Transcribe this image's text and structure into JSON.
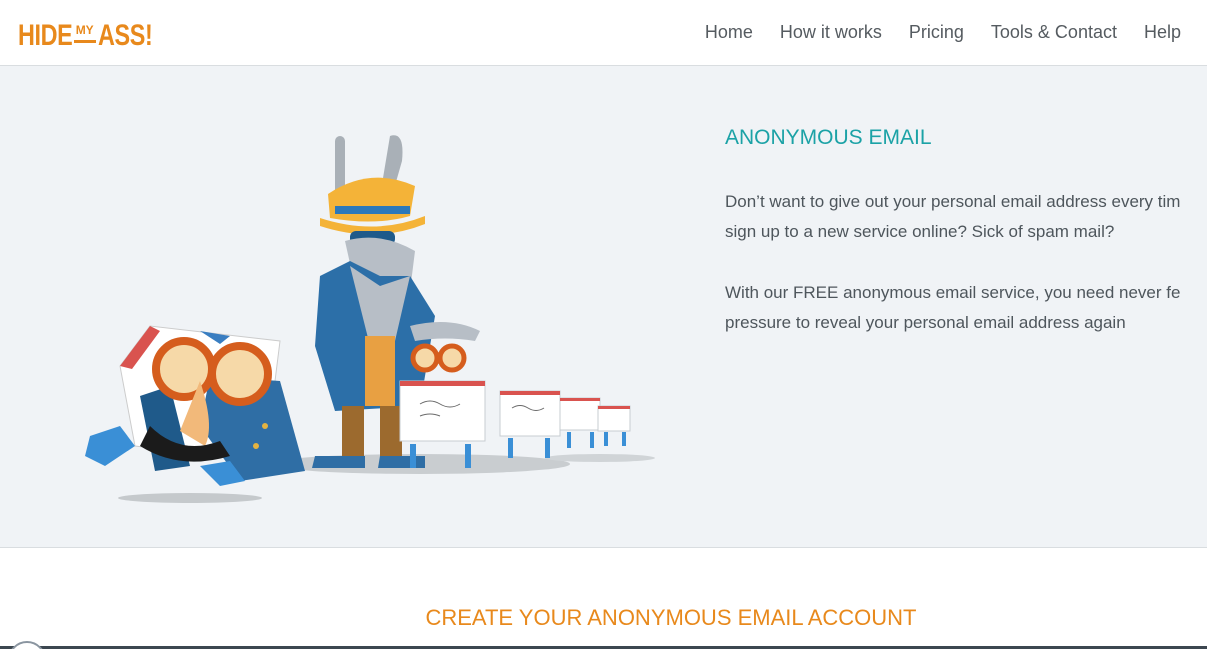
{
  "brand": {
    "logo_part1": "HIDE",
    "logo_part2": "MY",
    "logo_part3": "ASS!",
    "color": "#e8891c"
  },
  "nav": {
    "items": [
      {
        "label": "Home"
      },
      {
        "label": "How it works"
      },
      {
        "label": "Pricing"
      },
      {
        "label": "Tools & Contact"
      },
      {
        "label": "Help"
      }
    ]
  },
  "hero": {
    "title": "ANONYMOUS EMAIL",
    "title_color": "#1ba2a6",
    "paragraph1": {
      "line1": "Don’t want to give out your personal email address every tim",
      "line2": "sign up to a new service online? Sick of spam mail?"
    },
    "paragraph2": {
      "line1": "With our FREE anonymous email service, you need never fe",
      "line2": "pressure to reveal your personal email address again"
    },
    "illustration": "anonymous-email-mascot-illustration"
  },
  "create_section": {
    "title": "CREATE YOUR ANONYMOUS EMAIL ACCOUNT",
    "title_color": "#e8891c"
  }
}
